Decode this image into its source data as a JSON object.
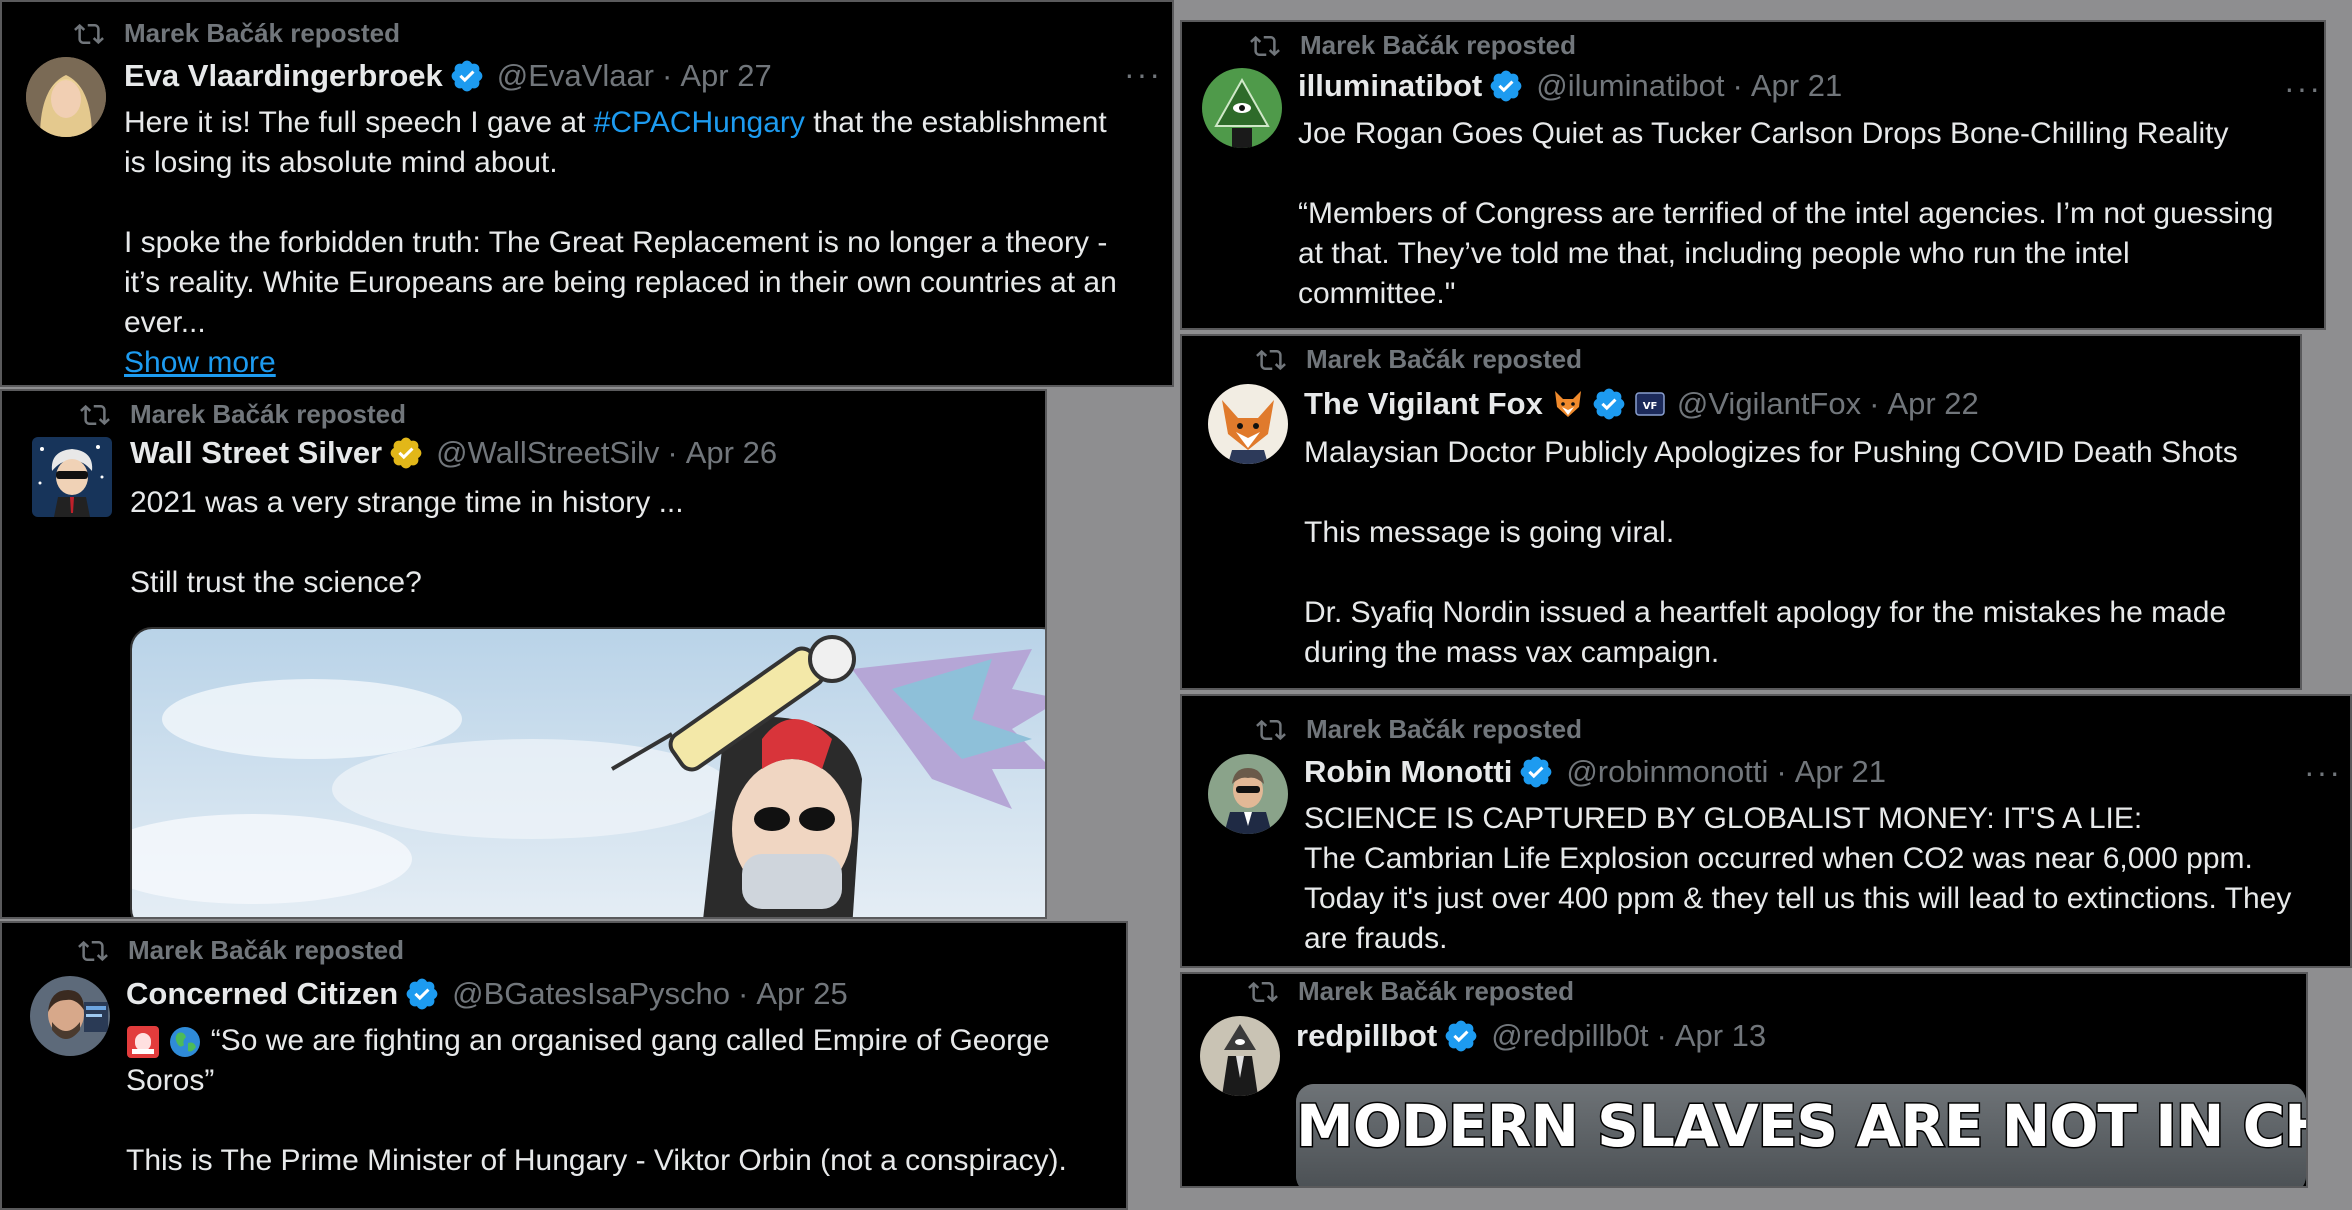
{
  "repost_label": "Marek Bačák reposted",
  "more_label": "···",
  "tweets": {
    "eva": {
      "name": "Eva Vlaardingerbroek",
      "handle": "@EvaVlaar",
      "date": "Apr 27",
      "line1_pre": "Here it is! The full speech I gave at ",
      "line1_link": "#CPACHungary",
      "line1_post": " that the establishment",
      "line2": "is losing its absolute mind about.",
      "line3": "I spoke the forbidden truth: The Great Replacement is no longer a theory -",
      "line4": "it’s reality. White Europeans are being replaced in their own countries at an",
      "line5": "ever...",
      "show_more": "Show more"
    },
    "wss": {
      "name": "Wall Street Silver",
      "handle": "@WallStreetSilv",
      "date": "Apr 26",
      "line1": "2021 was a very strange time in history ...",
      "line2": "Still trust the science?"
    },
    "citizen": {
      "name": "Concerned Citizen",
      "handle": "@BGatesIsaPyscho",
      "date": "Apr 25",
      "line1": "“So we are fighting an organised gang called Empire of George",
      "line2": "Soros”",
      "line3": "This is The Prime Minister of Hungary -  Viktor Orbin (not a conspiracy)."
    },
    "illum": {
      "name": "illuminatibot",
      "handle": "@iluminatibot",
      "date": "Apr 21",
      "line1": "Joe Rogan Goes Quiet as Tucker Carlson Drops Bone-Chilling Reality",
      "line2": "“Members of Congress are terrified of the intel agencies. I’m not guessing",
      "line3": "at that. They’ve told me that, including people who run the intel",
      "line4": "committee.\""
    },
    "fox": {
      "name": "The Vigilant Fox",
      "handle": "@VigilantFox",
      "date": "Apr 22",
      "line1": "Malaysian Doctor Publicly Apologizes for Pushing COVID Death Shots",
      "line2": "This message is going viral.",
      "line3": "Dr. Syafiq Nordin issued a heartfelt apology for the mistakes he made",
      "line4": "during the mass vax campaign."
    },
    "robin": {
      "name": "Robin Monotti",
      "handle": "@robinmonotti",
      "date": "Apr 21",
      "line1": "SCIENCE IS CAPTURED BY GLOBALIST MONEY: IT'S A LIE:",
      "line2": "The Cambrian Life Explosion occurred when CO2 was near 6,000 ppm.",
      "line3": "Today it's just over 400 ppm & they tell us this will lead to extinctions. They",
      "line4": "are frauds."
    },
    "red": {
      "name": "redpillbot",
      "handle": "@redpillb0t",
      "date": "Apr 13",
      "image_caption": "MODERN SLAVES ARE NOT IN CHAINS"
    }
  },
  "colors": {
    "background": "#8e8e90",
    "card": "#000000",
    "text": "#e7e9ea",
    "muted": "#71767b",
    "link": "#1d9bf0",
    "verified_blue": "#1d9bf0",
    "verified_gold": "#e2b719"
  },
  "icons": [
    "repost-icon",
    "verified-badge-icon",
    "more-options-icon",
    "fox-emoji-icon",
    "siren-emoji-icon",
    "globe-emoji-icon",
    "channel-badge-icon"
  ]
}
